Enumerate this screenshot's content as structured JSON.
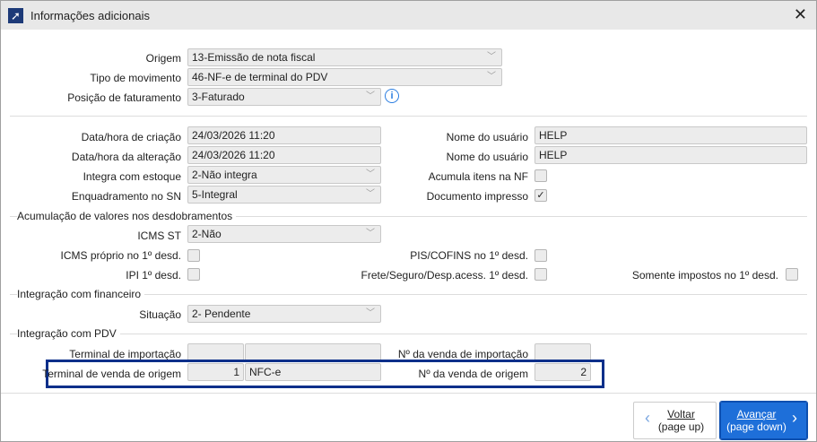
{
  "window": {
    "title": "Informações adicionais"
  },
  "top": {
    "origem_label": "Origem",
    "origem": "13-Emissão de nota fiscal",
    "tipo_label": "Tipo de movimento",
    "tipo": "46-NF-e de terminal do PDV",
    "posicao_label": "Posição de faturamento",
    "posicao": "3-Faturado"
  },
  "info": {
    "criacao_label": "Data/hora de criação",
    "criacao": "24/03/2026 11:20",
    "alteracao_label": "Data/hora da alteração",
    "alteracao": "24/03/2026 11:20",
    "integra_label": "Integra com estoque",
    "integra": "2-Não integra",
    "enquadramento_label": "Enquadramento no SN",
    "enquadramento": "5-Integral",
    "usuario1_label": "Nome do usuário",
    "usuario1": "HELP",
    "usuario2_label": "Nome do usuário",
    "usuario2": "HELP",
    "acumula_label": "Acumula itens na NF",
    "acumula_checked": false,
    "impresso_label": "Documento impresso",
    "impresso_checked": true,
    "check_mark": "✓"
  },
  "acumulacao": {
    "title": "Acumulação de valores nos desdobramentos",
    "icms_st_label": "ICMS ST",
    "icms_st": "2-Não",
    "icms_proprio_label": "ICMS próprio no 1º desd.",
    "ipi_label": "IPI 1º desd.",
    "pis_label": "PIS/COFINS no 1º desd.",
    "frete_label": "Frete/Seguro/Desp.acess. 1º desd.",
    "somente_label": "Somente impostos no 1º desd."
  },
  "financeiro": {
    "title": "Integração com financeiro",
    "situacao_label": "Situação",
    "situacao": "2- Pendente"
  },
  "pdv": {
    "title": "Integração com PDV",
    "terminal_imp_label": "Terminal de importação",
    "venda_imp_label": "Nº da venda de importação",
    "terminal_orig_label": "Terminal de venda de origem",
    "terminal_orig_num": "1",
    "terminal_orig_name": "NFC-e",
    "venda_orig_label": "Nº da venda de origem",
    "venda_orig": "2"
  },
  "buttons": {
    "voltar": "Voltar",
    "voltar_hint": "(page up)",
    "avancar": "Avançar",
    "avancar_hint": "(page down)"
  },
  "colors": {
    "accent": "#1e6fd9",
    "highlight": "#0b2f8a"
  }
}
